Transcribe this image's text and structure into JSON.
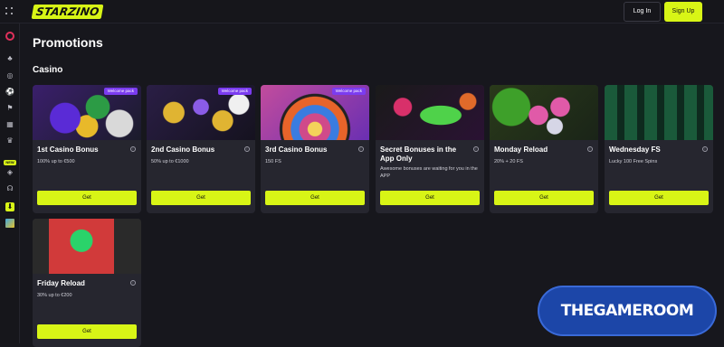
{
  "header": {
    "logo_text": "STARZINO",
    "login_label": "Log In",
    "signup_label": "Sign Up"
  },
  "sidebar": {
    "new_badge": "NEW"
  },
  "main": {
    "title": "Promotions",
    "section": "Casino",
    "cards": [
      {
        "title": "1st Casino Bonus",
        "subtitle": "100% up to €500",
        "badge": "Welcome pack",
        "button": "Get"
      },
      {
        "title": "2nd Casino Bonus",
        "subtitle": "50% up to €1000",
        "badge": "Welcome pack",
        "button": "Get"
      },
      {
        "title": "3rd Casino Bonus",
        "subtitle": "150 FS",
        "badge": "Welcome pack",
        "button": "Get"
      },
      {
        "title": "Secret Bonuses in the App Only",
        "subtitle": "Awesome bonuses are waiting for you in the APP",
        "badge": "",
        "button": "Get"
      },
      {
        "title": "Monday Reload",
        "subtitle": "20% + 20 FS",
        "badge": "",
        "button": "Get"
      },
      {
        "title": "Wednesday FS",
        "subtitle": "Lucky 100 Free Spins",
        "badge": "",
        "button": "Get"
      },
      {
        "title": "Friday Reload",
        "subtitle": "30% up to €200",
        "badge": "",
        "button": "Get"
      }
    ]
  },
  "watermark": {
    "text": "THEGAMEROOM"
  },
  "colors": {
    "accent": "#d8f516",
    "background": "#17171d",
    "card": "#26262f",
    "badge": "#7b3cf0"
  }
}
